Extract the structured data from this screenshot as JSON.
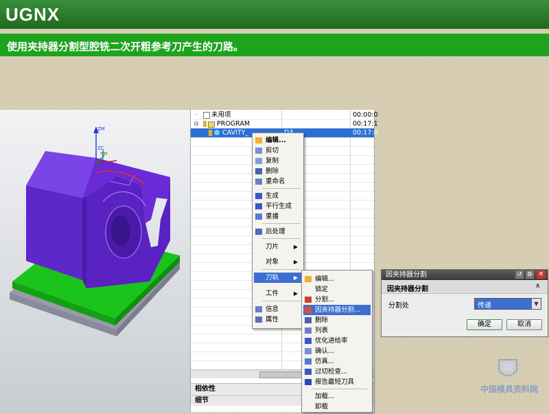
{
  "slide": {
    "title": "UGNX",
    "subtitle": "使用夹持器分割型腔铣二次开粗参考刀产生的刀路。"
  },
  "viewport": {
    "axis_labels": {
      "zm": "ZM",
      "zc": "ZC",
      "ym": "YM"
    }
  },
  "navigator": {
    "rows": [
      {
        "name": "未用项",
        "time": "00:00:0"
      },
      {
        "name": "PROGRAM",
        "time": "00:17:1"
      },
      {
        "name": "CAVITY_",
        "tool": "D3",
        "time": "00:17:0"
      }
    ],
    "sections": [
      "相依性",
      "细节"
    ]
  },
  "context_menu": {
    "items": [
      {
        "label": "编辑..."
      },
      {
        "label": "剪切"
      },
      {
        "label": "复制"
      },
      {
        "label": "删除"
      },
      {
        "label": "重命名"
      },
      {
        "label": "生成"
      },
      {
        "label": "平行生成"
      },
      {
        "label": "重播"
      },
      {
        "label": "后处理"
      },
      {
        "label": "刀片"
      },
      {
        "label": "对象"
      },
      {
        "label": "刀轨"
      },
      {
        "label": "工件"
      },
      {
        "label": "信息"
      },
      {
        "label": "属性"
      }
    ]
  },
  "submenu": {
    "items": [
      {
        "label": "编辑..."
      },
      {
        "label": "锁定"
      },
      {
        "label": "分割..."
      },
      {
        "label": "因夹持器分割..."
      },
      {
        "label": "删除"
      },
      {
        "label": "列表"
      },
      {
        "label": "优化进给率"
      },
      {
        "label": "确认..."
      },
      {
        "label": "仿真..."
      },
      {
        "label": "过切检查..."
      },
      {
        "label": "报告最短刀具"
      },
      {
        "label": "加载..."
      },
      {
        "label": "卸载"
      }
    ]
  },
  "dialog": {
    "title": "因夹持器分割",
    "section": "因夹持器分割",
    "field_label": "分割处",
    "field_value": "传递",
    "ok": "确定",
    "cancel": "取消"
  },
  "watermark": "中国模具资料网",
  "colors": {
    "title_green": "#1f6a1f",
    "subtitle_green": "#1ea31e",
    "part_purple": "#6a2ad6",
    "base_green": "#1bc41b",
    "highlight_blue": "#3c6fd0"
  }
}
